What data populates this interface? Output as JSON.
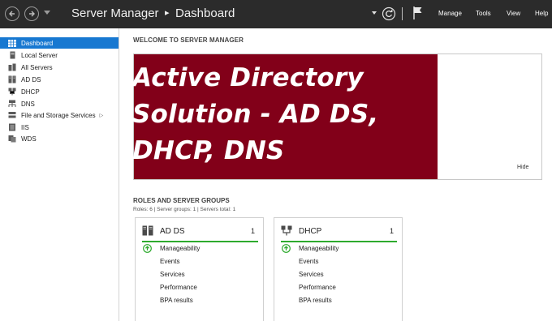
{
  "titlebar": {
    "breadcrumb_app": "Server Manager",
    "breadcrumb_sep": "▸",
    "breadcrumb_page": "Dashboard",
    "menus": [
      "Manage",
      "Tools",
      "View",
      "Help"
    ]
  },
  "sidebar": {
    "items": [
      {
        "label": "Dashboard",
        "icon": "dashboard-grid-icon",
        "active": true
      },
      {
        "label": "Local Server",
        "icon": "server-icon"
      },
      {
        "label": "All Servers",
        "icon": "servers-icon"
      },
      {
        "label": "AD DS",
        "icon": "ad-ds-icon"
      },
      {
        "label": "DHCP",
        "icon": "dhcp-icon"
      },
      {
        "label": "DNS",
        "icon": "dns-icon"
      },
      {
        "label": "File and Storage Services",
        "icon": "storage-icon",
        "expandable": true
      },
      {
        "label": "IIS",
        "icon": "iis-icon"
      },
      {
        "label": "WDS",
        "icon": "wds-icon"
      }
    ]
  },
  "welcome": {
    "title": "WELCOME TO SERVER MANAGER",
    "banner_lines": [
      "Active Directory",
      "Solution - AD DS,",
      "DHCP, DNS"
    ],
    "hide_label": "Hide"
  },
  "roles": {
    "title": "ROLES AND SERVER GROUPS",
    "subtitle": "Roles: 6   |   Server groups: 1   |   Servers total: 1",
    "cards": [
      {
        "name": "AD DS",
        "count": "1",
        "rows": [
          "Manageability",
          "Events",
          "Services",
          "Performance",
          "BPA results"
        ]
      },
      {
        "name": "DHCP",
        "count": "1",
        "rows": [
          "Manageability",
          "Events",
          "Services",
          "Performance",
          "BPA results"
        ]
      }
    ]
  },
  "colors": {
    "titlebar": "#2b2b2b",
    "accent": "#1778d1",
    "banner": "#820019",
    "status_green": "#2eaa2e"
  }
}
